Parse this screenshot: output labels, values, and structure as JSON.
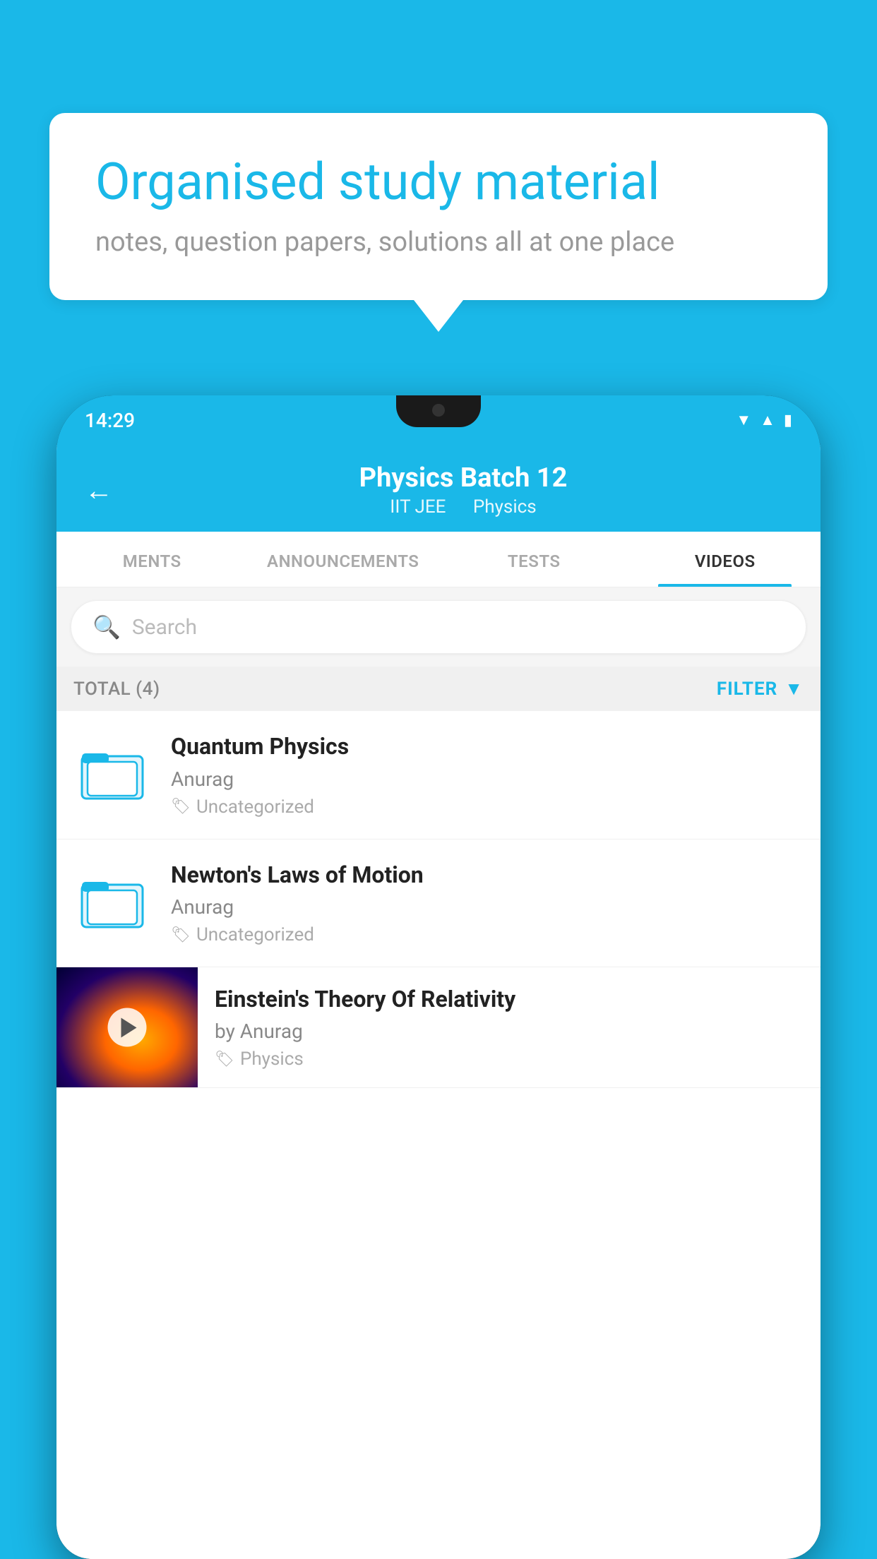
{
  "background_color": "#1ab8e8",
  "bubble": {
    "title": "Organised study material",
    "subtitle": "notes, question papers, solutions all at one place"
  },
  "status_bar": {
    "time": "14:29",
    "icons": [
      "wifi",
      "signal",
      "battery"
    ]
  },
  "header": {
    "title": "Physics Batch 12",
    "subtitle_parts": [
      "IIT JEE",
      "Physics"
    ],
    "back_label": "←"
  },
  "tabs": [
    {
      "label": "MENTS",
      "active": false
    },
    {
      "label": "ANNOUNCEMENTS",
      "active": false
    },
    {
      "label": "TESTS",
      "active": false
    },
    {
      "label": "VIDEOS",
      "active": true
    }
  ],
  "search": {
    "placeholder": "Search"
  },
  "filter": {
    "total_label": "TOTAL (4)",
    "filter_label": "FILTER"
  },
  "videos": [
    {
      "title": "Quantum Physics",
      "author": "Anurag",
      "tag": "Uncategorized",
      "has_thumbnail": false
    },
    {
      "title": "Newton's Laws of Motion",
      "author": "Anurag",
      "tag": "Uncategorized",
      "has_thumbnail": false
    },
    {
      "title": "Einstein's Theory Of Relativity",
      "author": "by Anurag",
      "tag": "Physics",
      "has_thumbnail": true
    }
  ]
}
